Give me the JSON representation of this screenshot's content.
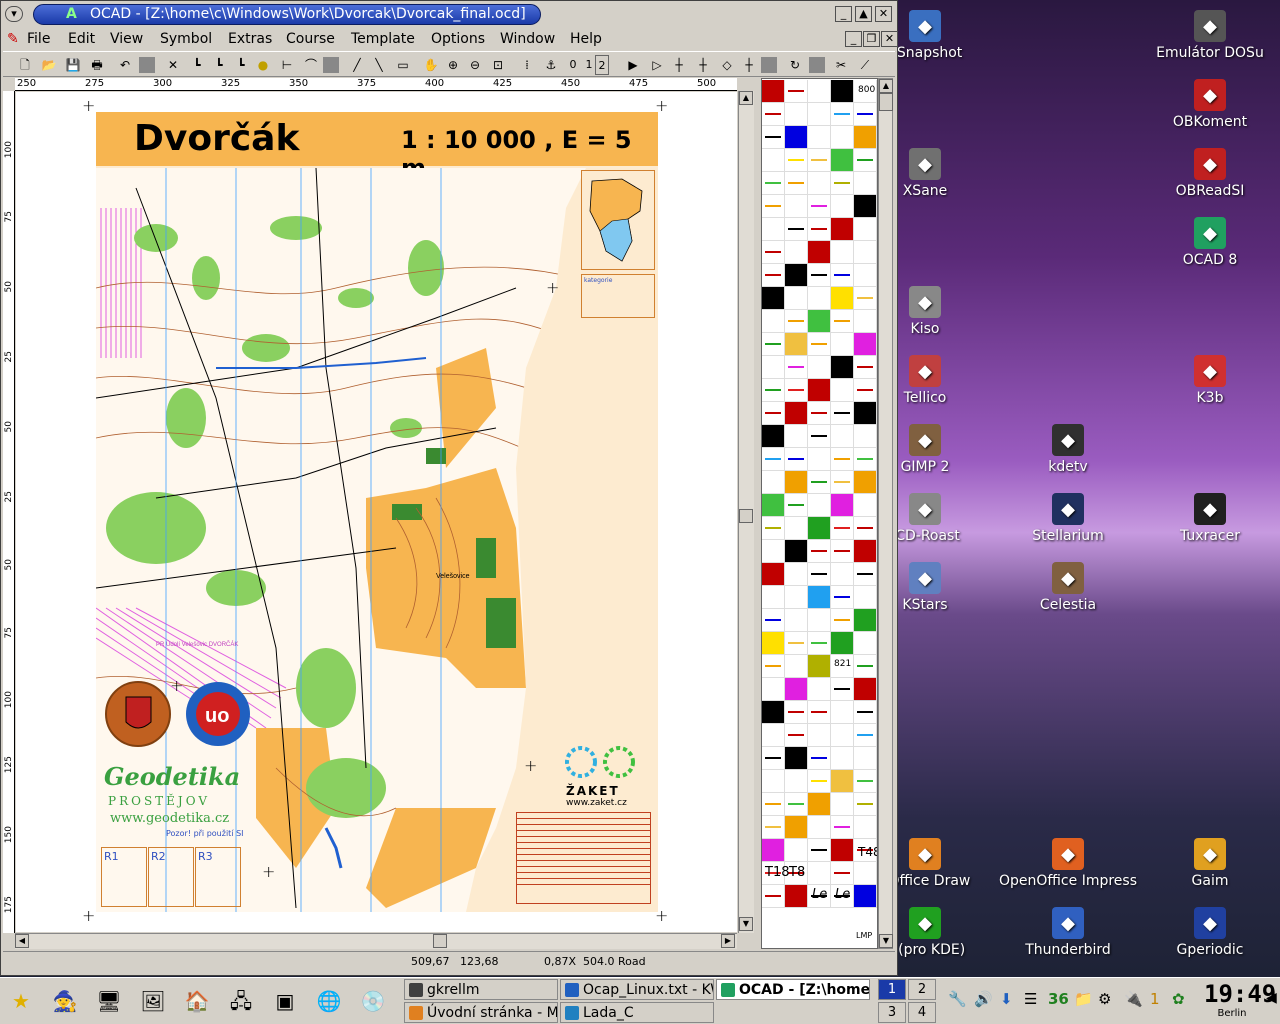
{
  "window": {
    "title": "OCAD  - [Z:\\home\\c\\Windows\\Work\\Dvorcak\\Dvorcak_final.ocd]",
    "logo": "A"
  },
  "menu": [
    "File",
    "Edit",
    "View",
    "Symbol",
    "Extras",
    "Course",
    "Template",
    "Options",
    "Window",
    "Help"
  ],
  "toolbar": {
    "icons": [
      "new-icon",
      "open-icon",
      "save-icon",
      "print-icon",
      "undo-icon",
      "blank-icon",
      "cut-icon",
      "stair1-icon",
      "stair2-icon",
      "stair3-icon",
      "pan-icon",
      "measure-icon",
      "bridge-icon",
      "zoom-in-icon",
      "zoom-out-icon",
      "zoom-window-icon",
      "grid-icon",
      "anchor-icon"
    ],
    "labels": [
      "0",
      "1",
      "2"
    ]
  },
  "ruler": {
    "top": [
      "250",
      "275",
      "300",
      "325",
      "350",
      "375",
      "400",
      "425",
      "450",
      "475",
      "500"
    ],
    "left": [
      "100",
      "75",
      "50",
      "25",
      "50",
      "25",
      "50",
      "75",
      "100",
      "125",
      "150",
      "175"
    ]
  },
  "map": {
    "title": "Dvorčák",
    "scale": "1 : 10 000 , E = 5 m",
    "sponsor": "Geodetika",
    "sponsor_city": "PROSTĚJOV",
    "sponsor_web": "www.geodetika.cz",
    "club": "ŽAKET",
    "club_web": "www.zaket.cz",
    "inset_label": "kategorie",
    "village": "Velešovice",
    "region_label": "PR Údolí Velešovic DVORČÁK",
    "sportident_note": "Pozor! při použití SI",
    "boxes": [
      "R1",
      "R2",
      "R3"
    ]
  },
  "palette": {
    "labels": [
      "800",
      "821",
      "5",
      "T18",
      "T8",
      "Le",
      "Le",
      "LMP",
      "T48"
    ]
  },
  "status": {
    "x": "509,67",
    "y": "123,68",
    "zoom": "0,87X",
    "symbol": "504.0 Road"
  },
  "desktop_icons": [
    {
      "label": "KSnapshot",
      "icon": "camera-icon",
      "color": "#3a6fc0"
    },
    {
      "label": "Emulátor DOSu",
      "icon": "terminal-icon",
      "color": "#555555"
    },
    {
      "label": "OBKoment",
      "icon": "pencil-icon",
      "color": "#c02020"
    },
    {
      "label": "XSane",
      "icon": "scanner-icon",
      "color": "#707070"
    },
    {
      "label": "OBReadSI",
      "icon": "readsi-icon",
      "color": "#c02020"
    },
    {
      "label": "OCAD 8",
      "icon": "ocad-icon",
      "color": "#20a060"
    },
    {
      "label": "Kiso",
      "icon": "kiso-icon",
      "color": "#888888"
    },
    {
      "label": "Tellico",
      "icon": "books-icon",
      "color": "#c04040"
    },
    {
      "label": "K3b",
      "icon": "k3b-icon",
      "color": "#d03030"
    },
    {
      "label": "GIMP 2",
      "icon": "gimp-icon",
      "color": "#806040"
    },
    {
      "label": "kdetv",
      "icon": "tv-icon",
      "color": "#303030"
    },
    {
      "label": "-CD-Roast",
      "icon": "cdroast-icon",
      "color": "#888888"
    },
    {
      "label": "Stellarium",
      "icon": "stellarium-icon",
      "color": "#203060"
    },
    {
      "label": "Tuxracer",
      "icon": "penguin-icon",
      "color": "#202020"
    },
    {
      "label": "KStars",
      "icon": "flask-icon",
      "color": "#6080c0"
    },
    {
      "label": "Celestia",
      "icon": "planet-icon",
      "color": "#806040"
    },
    {
      "label": "nOffice Draw",
      "icon": "draw-icon",
      "color": "#e08020"
    },
    {
      "label": "OpenOffice Impress",
      "icon": "impress-icon",
      "color": "#e06020"
    },
    {
      "label": "Gaim",
      "icon": "gaim-icon",
      "color": "#e0a020"
    },
    {
      "label": "n (pro KDE)",
      "icon": "icq-icon",
      "color": "#20a020"
    },
    {
      "label": "Thunderbird",
      "icon": "thunderbird-icon",
      "color": "#3060c0"
    },
    {
      "label": "Gperiodic",
      "icon": "atom-icon",
      "color": "#2040a0"
    }
  ],
  "taskbar": {
    "launchers": [
      "star-icon",
      "wizard-icon",
      "computer-icon",
      "image-icon",
      "home-icon",
      "network-icon",
      "terminal-icon",
      "globe-icon",
      "disk-icon"
    ],
    "tasks": [
      {
        "label": "gkrellm",
        "color": "#404040"
      },
      {
        "label": "Ocap_Linux.txt - KW",
        "color": "#2060c0"
      },
      {
        "label": "OCAD  - [Z:\\home\\c\\",
        "color": "#20a060"
      },
      {
        "label": "Úvodní stránka - Moz",
        "color": "#e08020"
      },
      {
        "label": "Lada_C",
        "color": "#2080c0"
      }
    ],
    "pager": [
      "1",
      "2",
      "3",
      "4"
    ],
    "tray": [
      "🔧",
      "🔊",
      "⬇",
      "☰",
      "36",
      "📁",
      "⚙",
      "🔌",
      "1",
      "✿"
    ],
    "clock": "19:49",
    "timezone": "Berlin"
  },
  "colors": {
    "title_blue": "#1a3aa8",
    "map_orange": "#f7b550",
    "map_bg": "#fdebd0"
  }
}
